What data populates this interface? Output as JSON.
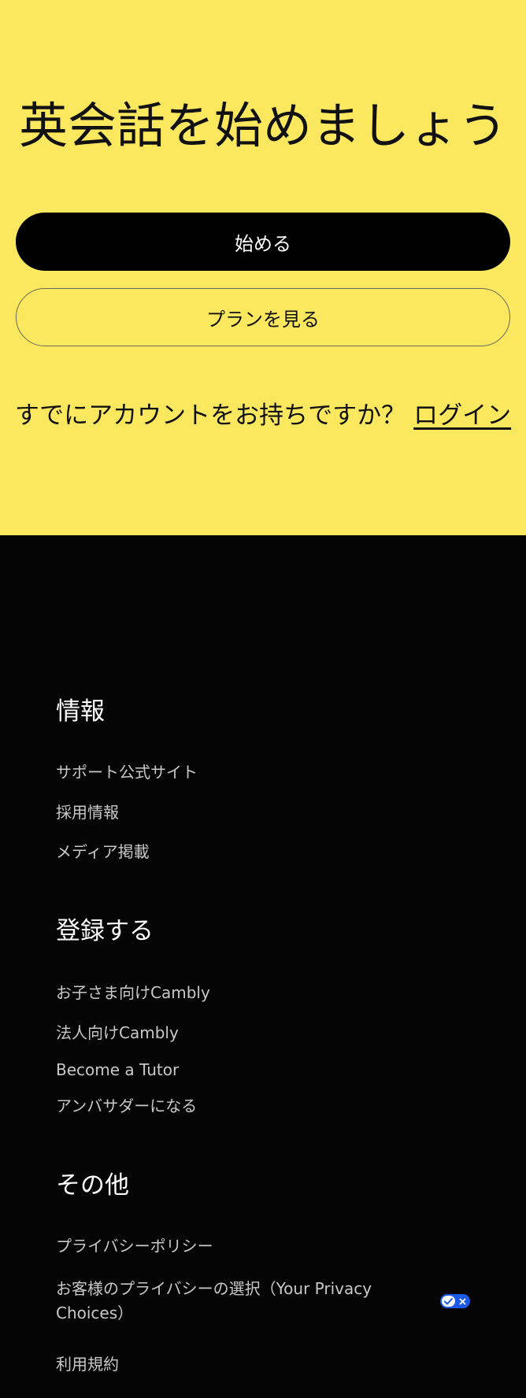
{
  "hero": {
    "title": "英会話を始めましょう",
    "start_button": "始める",
    "plans_button": "プランを見る",
    "login_prompt": "すでにアカウントをお持ちですか？",
    "login_link": "ログイン",
    "background_color": "#fce85e"
  },
  "footer": {
    "background_color": "#050505",
    "sections": [
      {
        "heading": "情報",
        "links": [
          "サポート公式サイト",
          "採用情報",
          "メディア掲載"
        ]
      },
      {
        "heading": "登録する",
        "links": [
          "お子さま向けCambly",
          "法人向けCambly",
          "Become a Tutor",
          "アンバサダーになる"
        ]
      },
      {
        "heading": "その他",
        "links": [
          "プライバシーポリシー",
          "お客様のプライバシーの選択（Your Privacy Choices）",
          "利用規約"
        ]
      }
    ],
    "privacy_choices_icon": "privacy-choices-toggle-icon",
    "privacy_toggle_color": "#1a5ae6"
  }
}
